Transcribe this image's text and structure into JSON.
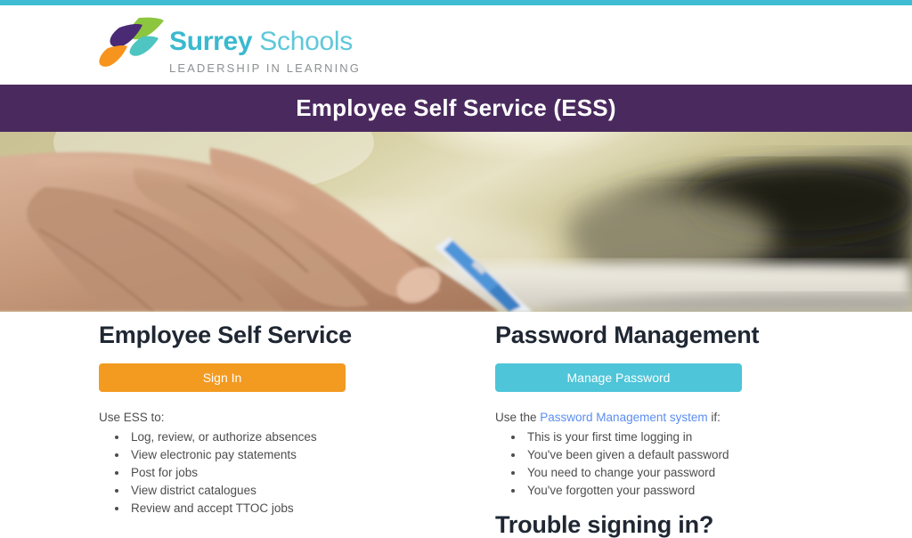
{
  "accent_bar": {
    "color": "#3fbcd4"
  },
  "logo": {
    "name_bold": "Surrey",
    "name_light": " Schools",
    "tagline": "LEADERSHIP IN LEARNING",
    "mark_icon": "four-leaf-swoosh-icon",
    "colors": {
      "green": "#8cc63f",
      "purple": "#4a2a74",
      "teal": "#4ec5c1",
      "orange": "#f7941e",
      "text_bold": "#3ab9cf",
      "text_light": "#5ec8d9",
      "tagline": "#8d8f91"
    }
  },
  "banner": {
    "title": "Employee Self Service (ESS)",
    "background": "#4a2a5e",
    "text_color": "#ffffff"
  },
  "hero": {
    "alt": "Close-up photo of a hand holding a pen writing in a notebook",
    "icon": "hero-photo"
  },
  "left_column": {
    "heading": "Employee Self Service",
    "button_label": "Sign In",
    "button_color": "#f39a21",
    "intro": "Use ESS to:",
    "items": [
      "Log, review, or authorize absences",
      "View electronic pay statements",
      "Post for jobs",
      "View district catalogues",
      "Review and accept TTOC jobs"
    ]
  },
  "right_column": {
    "heading": "Password Management",
    "button_label": "Manage Password",
    "button_color": "#4ec5d8",
    "intro_prefix": "Use the ",
    "intro_link": "Password Management system",
    "intro_suffix": " if:",
    "link_color": "#5b8def",
    "items": [
      "This is your first time logging in",
      "You've been given a default password",
      "You need to change your password",
      "You've forgotten your password"
    ],
    "trouble_heading": "Trouble signing in?"
  }
}
